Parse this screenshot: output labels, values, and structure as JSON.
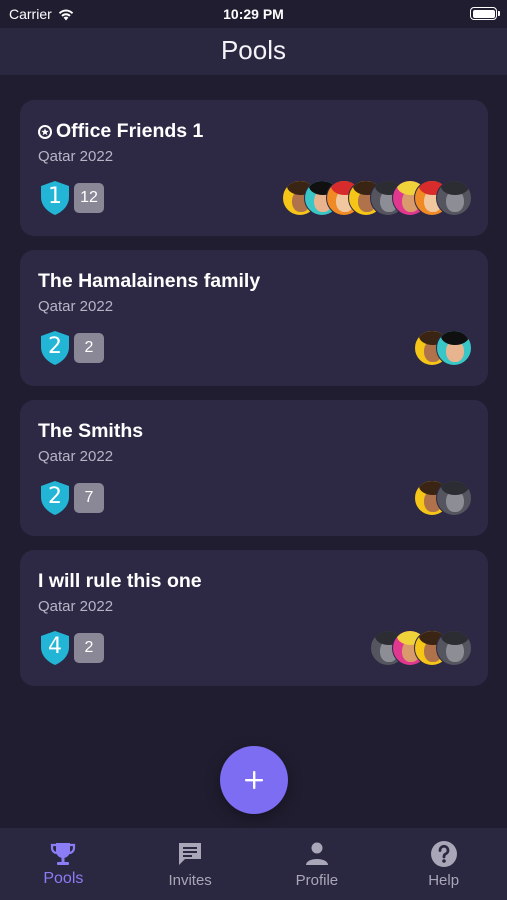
{
  "status_bar": {
    "carrier": "Carrier",
    "time": "10:29 PM"
  },
  "header": {
    "title": "Pools"
  },
  "colors": {
    "background": "#201d30",
    "card": "#2d2945",
    "accent": "#7c6df2",
    "rank_shield": "#22b5d6",
    "member_badge": "#8a8796"
  },
  "pools": [
    {
      "name": "Office Friends 1",
      "has_owner_icon": true,
      "tournament": "Qatar 2022",
      "rank": "1",
      "members": "12",
      "avatars": [
        "yellow",
        "teal",
        "orange",
        "yellow",
        "photo",
        "pink",
        "orange",
        "photo"
      ]
    },
    {
      "name": "The Hamalainens family",
      "has_owner_icon": false,
      "tournament": "Qatar 2022",
      "rank": "2",
      "members": "2",
      "avatars": [
        "yellow",
        "teal"
      ]
    },
    {
      "name": "The Smiths",
      "has_owner_icon": false,
      "tournament": "Qatar 2022",
      "rank": "2",
      "members": "7",
      "avatars": [
        "yellow",
        "photo"
      ]
    },
    {
      "name": "I will rule this one",
      "has_owner_icon": false,
      "tournament": "Qatar 2022",
      "rank": "4",
      "members": "2",
      "avatars": [
        "photo",
        "pink",
        "yellow",
        "photo"
      ]
    }
  ],
  "fab": {
    "icon": "plus-icon"
  },
  "tabs": [
    {
      "label": "Pools",
      "icon": "trophy-icon",
      "active": true
    },
    {
      "label": "Invites",
      "icon": "chat-icon",
      "active": false
    },
    {
      "label": "Profile",
      "icon": "person-icon",
      "active": false
    },
    {
      "label": "Help",
      "icon": "question-icon",
      "active": false
    }
  ]
}
